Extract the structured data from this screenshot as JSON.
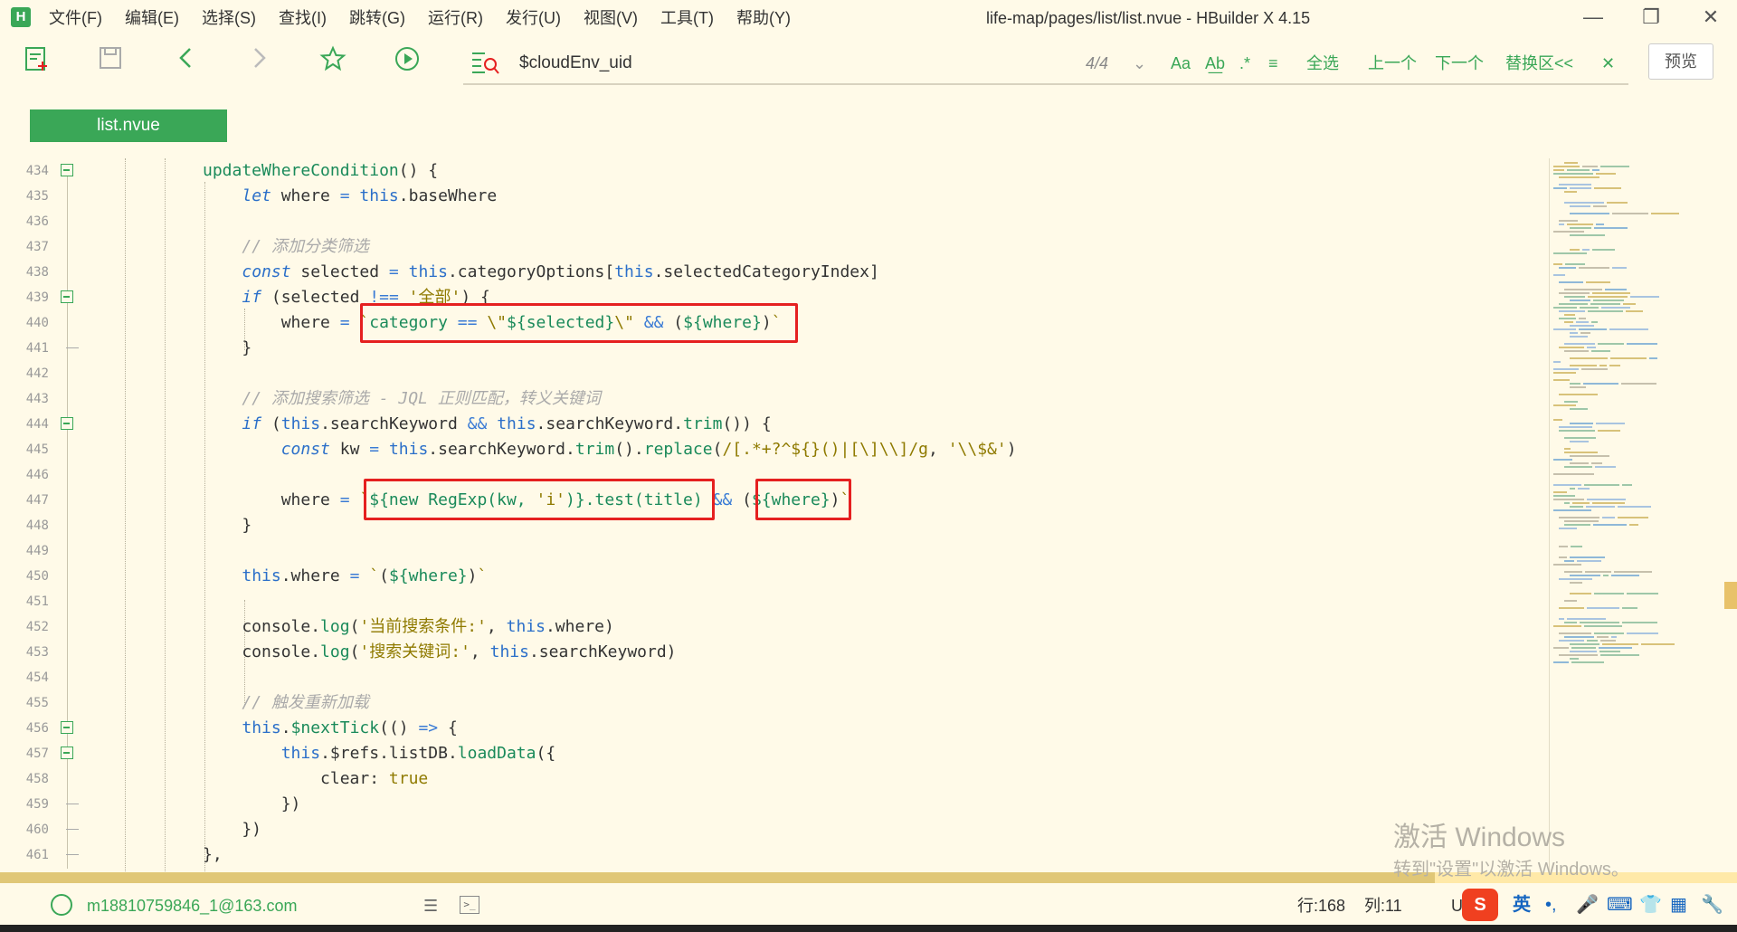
{
  "app": {
    "logo": "H",
    "menu": [
      "文件(F)",
      "编辑(E)",
      "选择(S)",
      "查找(I)",
      "跳转(G)",
      "运行(R)",
      "发行(U)",
      "视图(V)",
      "工具(T)",
      "帮助(Y)"
    ],
    "window_title": "life-map/pages/list/list.nvue - HBuilder X 4.15",
    "window_controls": {
      "minimize": "—",
      "restore": "❐",
      "close": "✕"
    }
  },
  "find": {
    "value": "$cloudEnv_uid",
    "count": "4/4",
    "chevron": "⌄",
    "case_label": "Aa",
    "word_label": "A͟b",
    "regex_label": ".*",
    "menu_label": "≡",
    "select_all": "全选",
    "prev": "上一个",
    "next": "下一个",
    "replace_label": "替换区<<",
    "close_label": "✕"
  },
  "preview_label": "预览",
  "tab": {
    "label": "list.nvue"
  },
  "editor": {
    "line_numbers": [
      "434",
      "435",
      "436",
      "437",
      "438",
      "439",
      "440",
      "441",
      "442",
      "443",
      "444",
      "445",
      "446",
      "447",
      "448",
      "449",
      "450",
      "451",
      "452",
      "453",
      "454",
      "455",
      "456",
      "457",
      "458",
      "459",
      "460",
      "461"
    ],
    "code_lines": [
      "updateWhereCondition() {",
      "  let where = this.baseWhere",
      "",
      "  // 添加分类筛选",
      "  const selected = this.categoryOptions[this.selectedCategoryIndex]",
      "  if (selected !== '全部') {",
      "    where = `category == \\\"${selected}\\\" && (${where})`",
      "  }",
      "",
      "  // 添加搜索筛选 - JQL 正则匹配，转义关键词",
      "  if (this.searchKeyword && this.searchKeyword.trim()) {",
      "    const kw = this.searchKeyword.trim().replace(/[.*+?^${}()|[\\]\\\\]/g, '\\\\$&')",
      "",
      "    where = `${new RegExp(kw, 'i')}.test(title) && (${where})`",
      "  }",
      "",
      "  this.where = `(${where})`",
      "",
      "  console.log('当前搜索条件:', this.where)",
      "  console.log('搜索关键词:', this.searchKeyword)",
      "",
      "  // 触发重新加载",
      "  this.$nextTick(() => {",
      "    this.$refs.listDB.loadData({",
      "      clear: true",
      "    })",
      "  })",
      "},"
    ]
  },
  "status": {
    "user": "m18810759846_1@163.com",
    "list_icon": "☰",
    "terminal_icon": ">_",
    "line": "行:168",
    "col": "列:11",
    "encoding_partial": "U"
  },
  "ime": {
    "logo": "S",
    "lang": "英",
    "punct": "•,",
    "mic": "🎤",
    "keyboard": "⌨",
    "shirt": "👕",
    "grid": "▦",
    "tools": "🔧"
  },
  "watermark": {
    "line1": "激活 Windows",
    "line2": "转到\"设置\"以激活 Windows。"
  },
  "colors": {
    "accent": "#3aa757",
    "background": "#fffae8",
    "highlight_box": "#e52020"
  }
}
